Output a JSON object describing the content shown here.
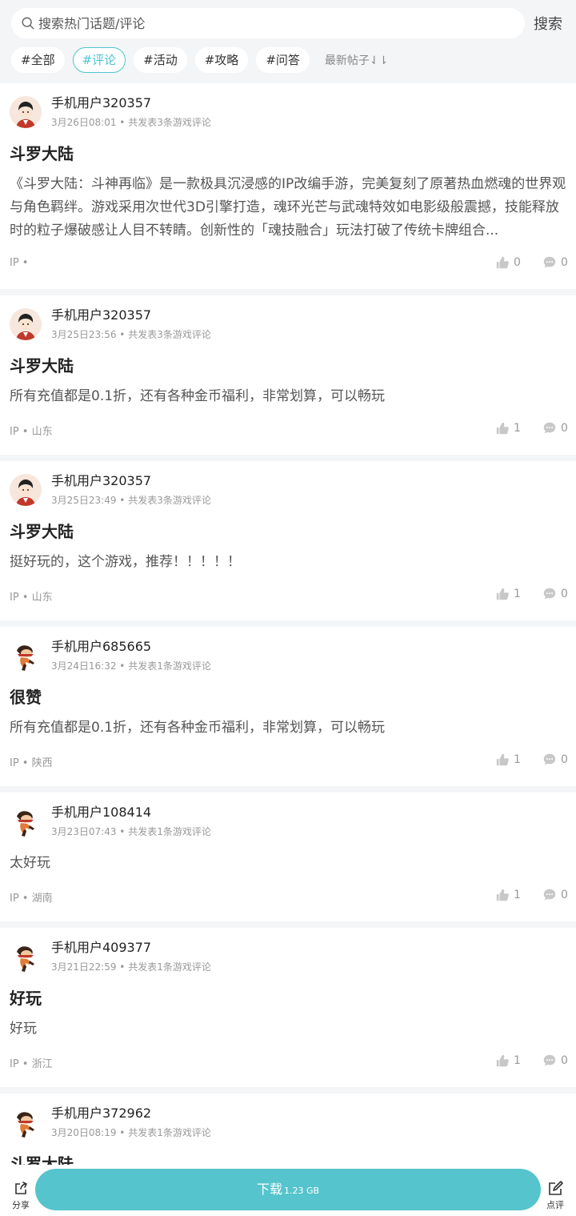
{
  "search": {
    "placeholder": "搜索热门话题/评论",
    "button_label": "搜索"
  },
  "tags": [
    {
      "label": "#全部",
      "active": false
    },
    {
      "label": "#评论",
      "active": true
    },
    {
      "label": "#活动",
      "active": false
    },
    {
      "label": "#攻略",
      "active": false
    },
    {
      "label": "#问答",
      "active": false
    }
  ],
  "sort_label": "最新帖子⇃⇂",
  "posts": [
    {
      "avatar": "boy-avatar",
      "user": "手机用户320357",
      "meta": "3月26日08:01 • 共发表3条游戏评论",
      "title": "斗罗大陆",
      "content": "《斗罗大陆：斗神再临》是一款极具沉浸感的IP改编手游，完美复刻了原著热血燃魂的世界观与角色羁绊。游戏采用次世代3D引擎打造，魂环光芒与武魂特效如电影级般震撼，技能释放时的粒子爆破感让人目不转睛。创新性的「魂技融合」玩法打破了传统卡牌组合...",
      "ip": "IP •",
      "likes": "0",
      "comments": "0"
    },
    {
      "avatar": "boy-avatar",
      "user": "手机用户320357",
      "meta": "3月25日23:56 • 共发表3条游戏评论",
      "title": "斗罗大陆",
      "content": "所有充值都是0.1折，还有各种金币福利，非常划算，可以畅玩",
      "ip": "IP • 山东",
      "likes": "1",
      "comments": "0"
    },
    {
      "avatar": "boy-avatar",
      "user": "手机用户320357",
      "meta": "3月25日23:49 • 共发表3条游戏评论",
      "title": "斗罗大陆",
      "content": "挺好玩的，这个游戏，推荐！！！！！",
      "ip": "IP • 山东",
      "likes": "1",
      "comments": "0"
    },
    {
      "avatar": "monkey-avatar",
      "user": "手机用户685665",
      "meta": "3月24日16:32 • 共发表1条游戏评论",
      "title": "很赞",
      "content": "所有充值都是0.1折，还有各种金币福利，非常划算，可以畅玩",
      "ip": "IP • 陕西",
      "likes": "1",
      "comments": "0"
    },
    {
      "avatar": "monkey-avatar",
      "user": "手机用户108414",
      "meta": "3月23日07:43 • 共发表1条游戏评论",
      "title": "",
      "content": "太好玩",
      "ip": "IP • 湖南",
      "likes": "1",
      "comments": "0"
    },
    {
      "avatar": "monkey-avatar",
      "user": "手机用户409377",
      "meta": "3月21日22:59 • 共发表1条游戏评论",
      "title": "好玩",
      "content": "好玩",
      "ip": "IP • 浙江",
      "likes": "1",
      "comments": "0"
    },
    {
      "avatar": "monkey-avatar",
      "user": "手机用户372962",
      "meta": "3月20日08:19 • 共发表1条游戏评论",
      "title": "斗罗大陆",
      "content": "",
      "ip": "",
      "likes": "",
      "comments": ""
    }
  ],
  "bottom_bar": {
    "share_label": "分享",
    "download_label": "下载",
    "download_size": "1.23 GB",
    "review_label": "点评"
  },
  "colors": {
    "accent": "#55c4cc",
    "tag_active": "#4fc3cf",
    "background": "#f4f5f7"
  }
}
